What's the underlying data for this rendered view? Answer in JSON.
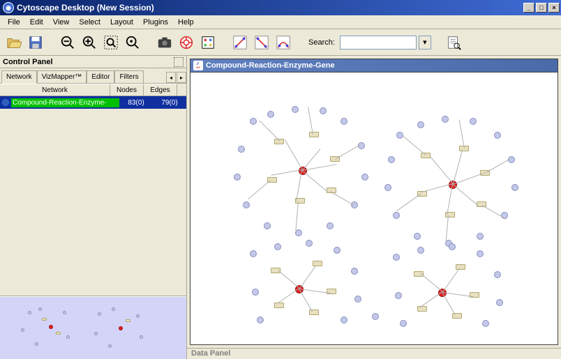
{
  "window": {
    "title": "Cytoscape Desktop (New Session)"
  },
  "menu": {
    "file": "File",
    "edit": "Edit",
    "view": "View",
    "select": "Select",
    "layout": "Layout",
    "plugins": "Plugins",
    "help": "Help"
  },
  "toolbar": {
    "search_label": "Search:"
  },
  "control_panel": {
    "title": "Control Panel",
    "tabs": {
      "network": "Network",
      "vizmapper": "VizMapper™",
      "editor": "Editor",
      "filters": "Filters"
    },
    "columns": {
      "network": "Network",
      "nodes": "Nodes",
      "edges": "Edges"
    },
    "rows": [
      {
        "name": "Compound-Reaction-Enzyme-",
        "nodes": "83(0)",
        "edges": "79(0)"
      }
    ]
  },
  "canvas": {
    "title": "Compound-Reaction-Enzyme-Gene"
  },
  "data_panel": {
    "title": "Data Panel"
  }
}
